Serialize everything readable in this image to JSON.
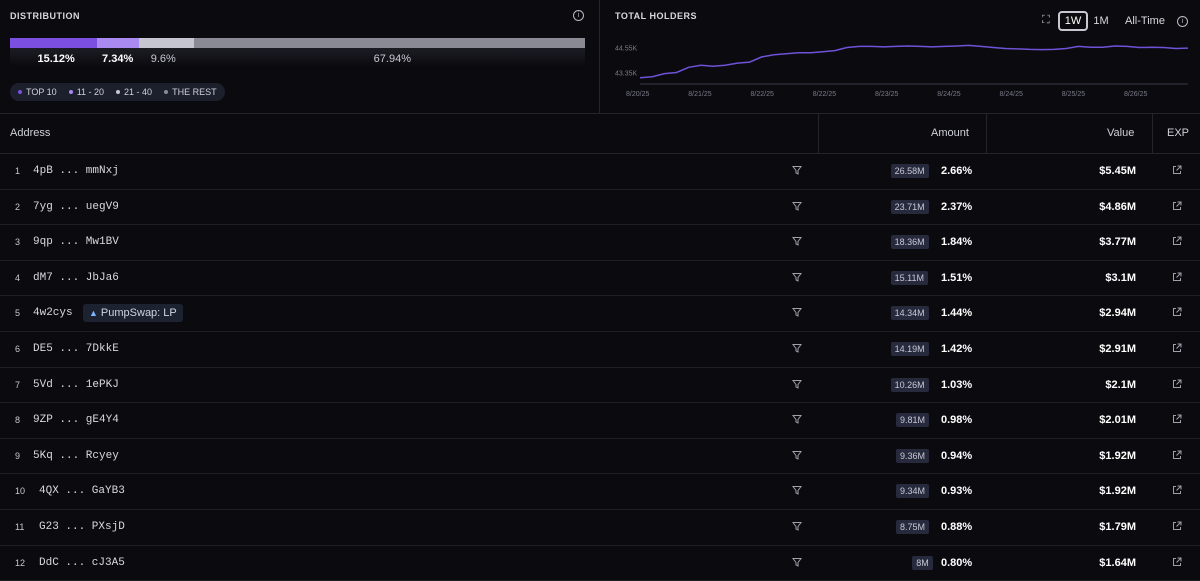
{
  "distribution": {
    "title": "DISTRIBUTION",
    "segments": [
      {
        "label": "15.12%",
        "percent": 15.12,
        "color": "#7b4fe0"
      },
      {
        "label": "7.34%",
        "percent": 7.34,
        "color": "#a98af0"
      },
      {
        "label": "9.6%",
        "percent": 9.6,
        "color": "#c6c6d0"
      },
      {
        "label": "67.94%",
        "percent": 67.94,
        "color": "#8a8a94"
      }
    ],
    "legend": [
      {
        "label": "TOP 10",
        "color": "#7b4fe0"
      },
      {
        "label": "11 - 20",
        "color": "#a98af0"
      },
      {
        "label": "21 - 40",
        "color": "#c6c6d0"
      },
      {
        "label": "THE REST",
        "color": "#8a8a94"
      }
    ]
  },
  "holders": {
    "title": "TOTAL HOLDERS",
    "ranges": [
      "1W",
      "1M",
      "All-Time"
    ],
    "active_range": "1W"
  },
  "chart_data": {
    "type": "line",
    "title": "TOTAL HOLDERS",
    "ylabels": [
      "44.55K",
      "43.35K"
    ],
    "xlabels": [
      "8/20/25",
      "8/21/25",
      "8/22/25",
      "8/22/25",
      "8/23/25",
      "8/24/25",
      "8/24/25",
      "8/25/25",
      "8/26/25"
    ],
    "ylim": [
      42800,
      45100
    ],
    "series": [
      {
        "color": "#6e52d8",
        "values": [
          43100,
          43150,
          43300,
          43350,
          43600,
          43700,
          43650,
          43700,
          43800,
          43850,
          44100,
          44200,
          44250,
          44300,
          44300,
          44350,
          44400,
          44550,
          44600,
          44600,
          44580,
          44600,
          44620,
          44600,
          44580,
          44600,
          44620,
          44650,
          44600,
          44550,
          44500,
          44480,
          44460,
          44450,
          44460,
          44500,
          44600,
          44560,
          44560,
          44620,
          44600,
          44550,
          44560,
          44550,
          44500,
          44520
        ]
      }
    ]
  },
  "table": {
    "headers": {
      "address": "Address",
      "amount": "Amount",
      "value": "Value",
      "exp": "EXP"
    },
    "rows": [
      {
        "rank": "1",
        "prefix": "4pB",
        "suffix": "mmNxj",
        "tag": "",
        "amount": "26.58M",
        "pct": "2.66%",
        "value": "$5.45M"
      },
      {
        "rank": "2",
        "prefix": "7yg",
        "suffix": "uegV9",
        "tag": "",
        "amount": "23.71M",
        "pct": "2.37%",
        "value": "$4.86M"
      },
      {
        "rank": "3",
        "prefix": "9qp",
        "suffix": "Mw1BV",
        "tag": "",
        "amount": "18.36M",
        "pct": "1.84%",
        "value": "$3.77M"
      },
      {
        "rank": "4",
        "prefix": "dM7",
        "suffix": "JbJa6",
        "tag": "",
        "amount": "15.11M",
        "pct": "1.51%",
        "value": "$3.1M"
      },
      {
        "rank": "5",
        "prefix": "4w2cys",
        "suffix": "",
        "tag": "PumpSwap: LP",
        "amount": "14.34M",
        "pct": "1.44%",
        "value": "$2.94M"
      },
      {
        "rank": "6",
        "prefix": "DE5",
        "suffix": "7DkkE",
        "tag": "",
        "amount": "14.19M",
        "pct": "1.42%",
        "value": "$2.91M"
      },
      {
        "rank": "7",
        "prefix": "5Vd",
        "suffix": "1ePKJ",
        "tag": "",
        "amount": "10.26M",
        "pct": "1.03%",
        "value": "$2.1M"
      },
      {
        "rank": "8",
        "prefix": "9ZP",
        "suffix": "gE4Y4",
        "tag": "",
        "amount": "9.81M",
        "pct": "0.98%",
        "value": "$2.01M"
      },
      {
        "rank": "9",
        "prefix": "5Kq",
        "suffix": "Rcyey",
        "tag": "",
        "amount": "9.36M",
        "pct": "0.94%",
        "value": "$1.92M"
      },
      {
        "rank": "10",
        "prefix": "4QX",
        "suffix": "GaYB3",
        "tag": "",
        "amount": "9.34M",
        "pct": "0.93%",
        "value": "$1.92M"
      },
      {
        "rank": "11",
        "prefix": "G23",
        "suffix": "PXsjD",
        "tag": "",
        "amount": "8.75M",
        "pct": "0.88%",
        "value": "$1.79M"
      },
      {
        "rank": "12",
        "prefix": "DdC",
        "suffix": "cJ3A5",
        "tag": "",
        "amount": "8M",
        "pct": "0.80%",
        "value": "$1.64M"
      }
    ]
  }
}
